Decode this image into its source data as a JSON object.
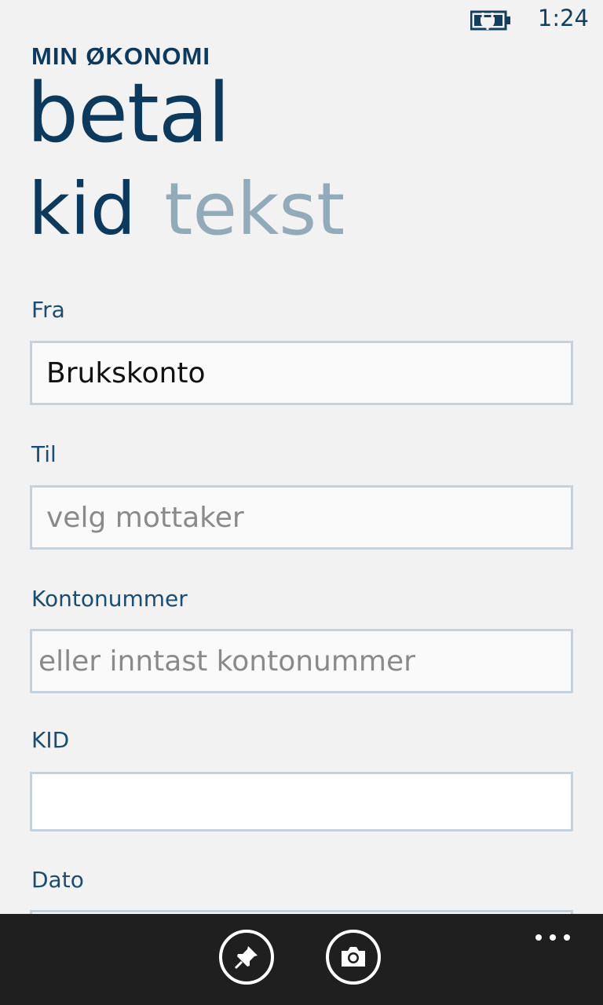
{
  "status_bar": {
    "time": "1:24",
    "battery_icon": "battery-charging-icon"
  },
  "header": {
    "app_title": "MIN ØKONOMI",
    "page_title": "betal",
    "pivot_items": [
      {
        "label": "kid",
        "active": true
      },
      {
        "label": "tekst",
        "active": false
      }
    ]
  },
  "form": {
    "from": {
      "label": "Fra",
      "value": "Brukskonto"
    },
    "to": {
      "label": "Til",
      "placeholder": "velg mottaker"
    },
    "account_number": {
      "label": "Kontonummer",
      "placeholder": "eller inntast kontonummer"
    },
    "kid": {
      "label": "KID",
      "value": ""
    },
    "date": {
      "label": "Dato"
    }
  },
  "app_bar": {
    "buttons": [
      {
        "icon": "pin-icon"
      },
      {
        "icon": "camera-icon"
      }
    ],
    "more_icon": "ellipsis-icon"
  },
  "colors": {
    "accent": "#0d3a5c",
    "pivot_inactive": "#93aab8",
    "field_border": "#c5d1db",
    "background": "#f2f2f2",
    "app_bar": "#1f1f1f"
  }
}
